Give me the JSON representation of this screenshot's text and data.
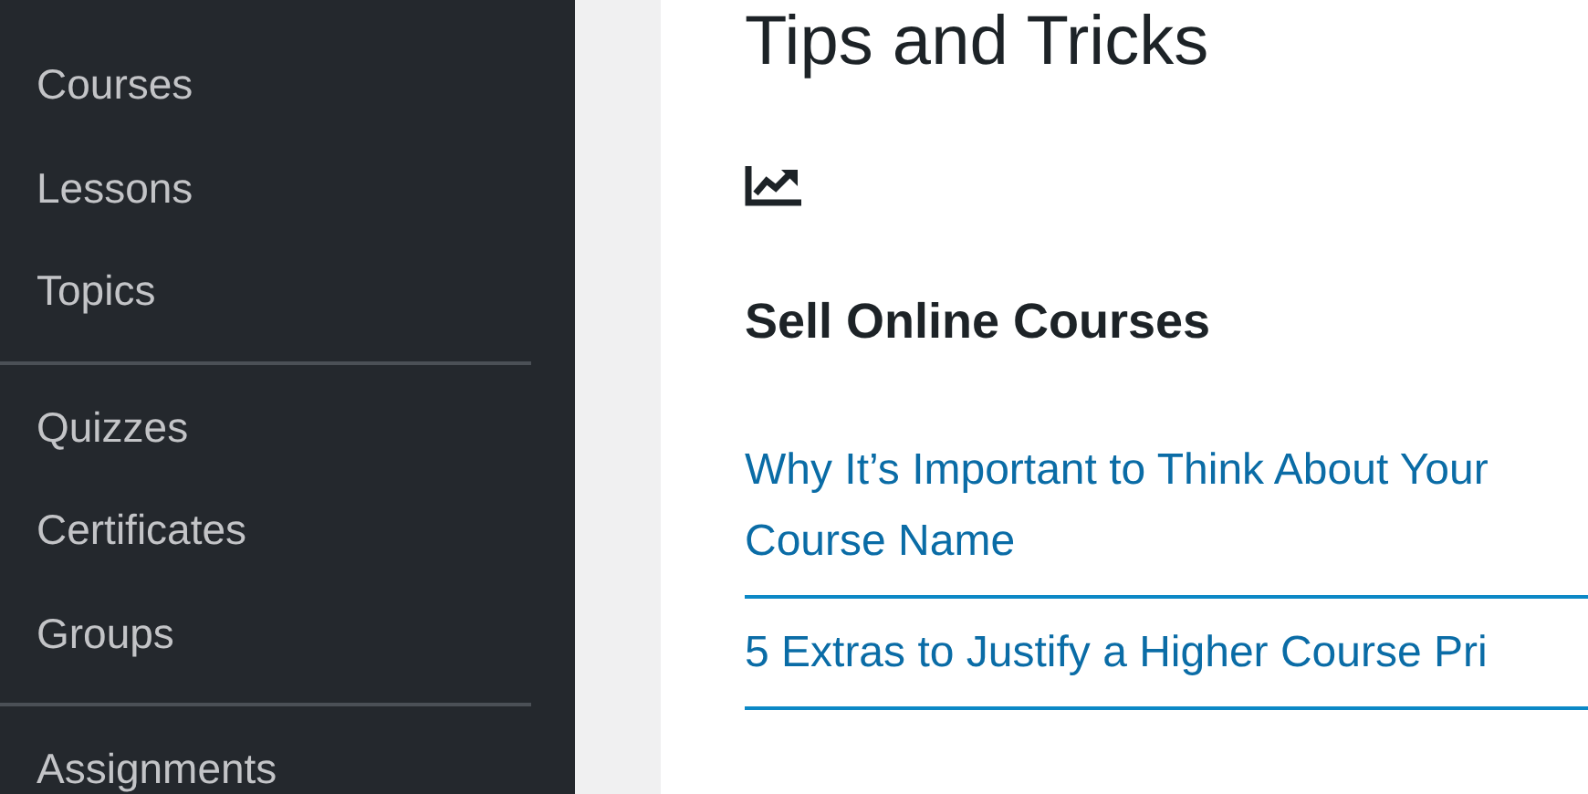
{
  "sidebar": {
    "groups": [
      {
        "items": [
          {
            "label": "Courses"
          },
          {
            "label": "Lessons"
          },
          {
            "label": "Topics"
          }
        ]
      },
      {
        "items": [
          {
            "label": "Quizzes"
          },
          {
            "label": "Certificates"
          },
          {
            "label": "Groups"
          }
        ]
      },
      {
        "items": [
          {
            "label": "Assignments"
          }
        ]
      }
    ]
  },
  "main": {
    "title": "Tips and Tricks",
    "section": {
      "heading": "Sell Online Courses",
      "links": [
        {
          "text": "Why It’s Important to Think About Your Course Name"
        },
        {
          "text": "5 Extras to Justify a Higher Course Pri"
        }
      ]
    }
  }
}
